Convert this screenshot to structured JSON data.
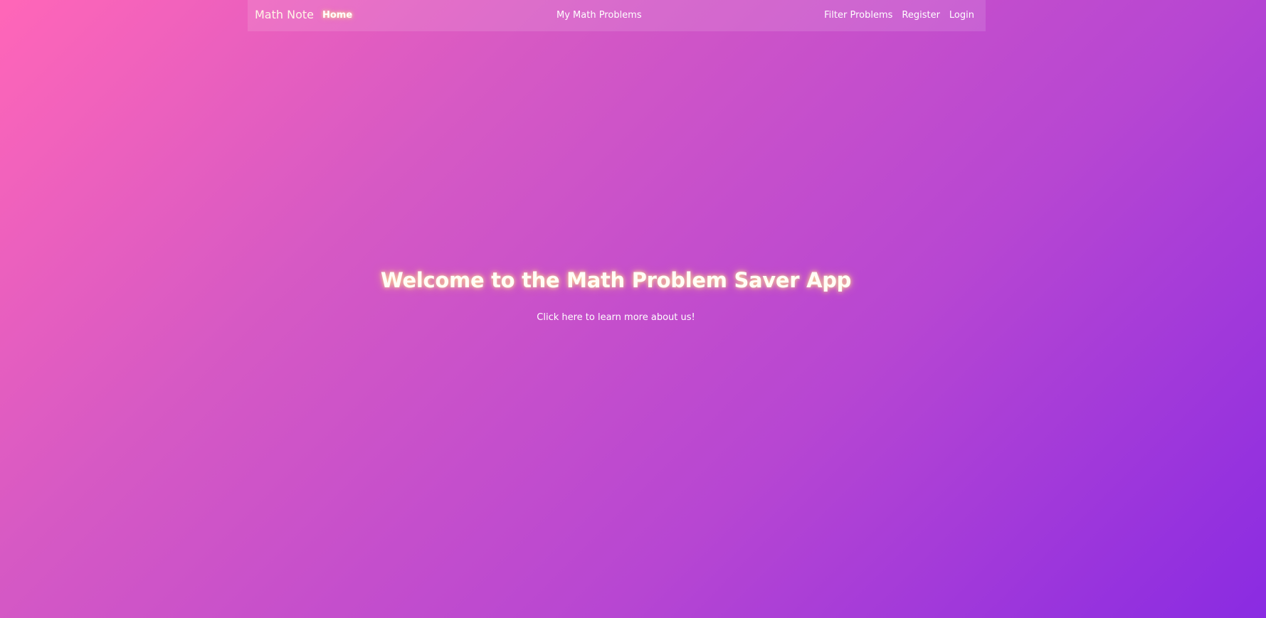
{
  "nav": {
    "brand": "Math Note",
    "home": "Home",
    "my_problems": "My Math Problems",
    "filter": "Filter Problems",
    "register": "Register",
    "login": "Login"
  },
  "hero": {
    "title": "Welcome to the Math Problem Saver App",
    "link": "Click here to learn more about us!"
  },
  "colors": {
    "gradient_start": "#ff66b8",
    "gradient_end": "#8a2be2",
    "glow": "#ffd890"
  }
}
